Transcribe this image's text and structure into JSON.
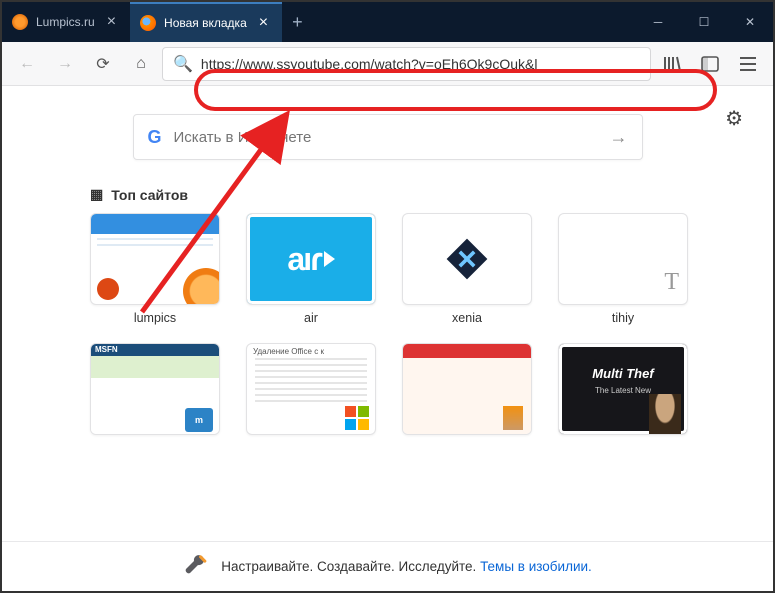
{
  "tabs": [
    {
      "label": "Lumpics.ru",
      "active": false
    },
    {
      "label": "Новая вкладка",
      "active": true
    }
  ],
  "url": "https://www.ssyoutube.com/watch?v=oEh6Ok9cQuk&l",
  "search": {
    "placeholder": "Искать в Интернете"
  },
  "section_title": "Топ сайтов",
  "tiles_row1": [
    {
      "label": "lumpics",
      "kind": "lumpics"
    },
    {
      "label": "air",
      "kind": "air"
    },
    {
      "label": "xenia",
      "kind": "xenia"
    },
    {
      "label": "tihiy",
      "kind": "tihiy"
    }
  ],
  "footer": {
    "text": "Настраивайте. Создавайте. Исследуйте. ",
    "link": "Темы в изобилии."
  },
  "thumb_msfn_title": "MSFN",
  "thumb_office_title": "Удаление Office с к",
  "thumb_multi_title": "Multi Thef",
  "thumb_multi_sub": "The Latest New"
}
